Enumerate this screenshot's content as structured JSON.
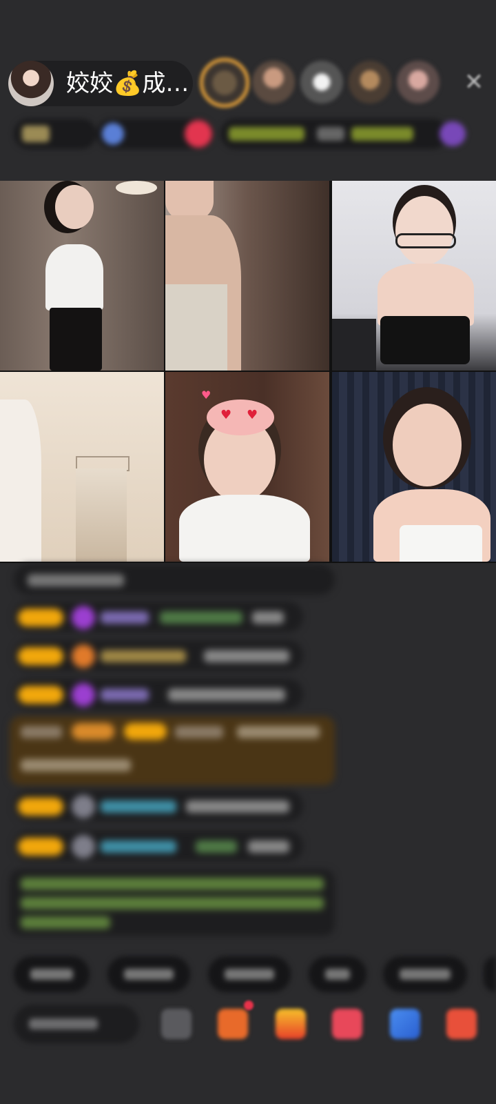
{
  "host": {
    "name": "姣姣💰成…"
  },
  "header": {
    "close_label": "✕"
  },
  "colors": {
    "background": "#2b2b2d",
    "level_badge": "#f1a70c",
    "chat_bubble": "#1d1d1f",
    "highlight_bubble": "#4a3515",
    "system_text": "#5c7f3b"
  },
  "icons": {
    "avatar": "host-avatar",
    "close": "close-icon",
    "gift": "gift-icon",
    "chat": "message-icon"
  }
}
